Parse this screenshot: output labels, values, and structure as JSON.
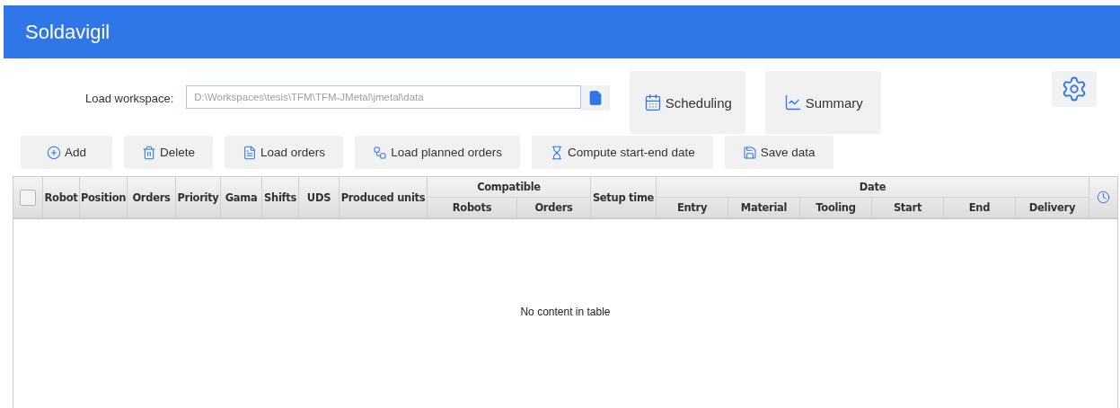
{
  "app": {
    "title": "Soldavigil"
  },
  "workspace": {
    "label": "Load workspace:",
    "value": "D:\\Workspaces\\tesis\\TFM\\TFM-JMetal\\jmetal\\data",
    "disabled": true
  },
  "nav_buttons": [
    {
      "kind": "calendar",
      "label": "Scheduling"
    },
    {
      "kind": "chart",
      "label": "Summary"
    }
  ],
  "toolbar": [
    {
      "kind": "add",
      "label": "Add"
    },
    {
      "kind": "delete",
      "label": "Delete"
    },
    {
      "kind": "file",
      "label": "Load orders"
    },
    {
      "kind": "plan",
      "label": "Load planned orders"
    },
    {
      "kind": "hourglass",
      "label": "Compute start-end date"
    },
    {
      "kind": "save",
      "label": "Save data"
    }
  ],
  "table": {
    "select_all": {
      "checked": false
    },
    "columns": [
      {
        "label": "Robot"
      },
      {
        "label": "Position"
      },
      {
        "label": "Orders"
      },
      {
        "label": "Priority"
      },
      {
        "label": "Gama"
      },
      {
        "label": "Shifts"
      },
      {
        "label": "UDS"
      },
      {
        "label": "Produced units"
      },
      {
        "label": "Compatible",
        "children": [
          {
            "label": "Robots"
          },
          {
            "label": "Orders"
          }
        ]
      },
      {
        "label": "Setup time"
      },
      {
        "label": "Date",
        "children": [
          {
            "label": "Entry"
          },
          {
            "label": "Material"
          },
          {
            "label": "Tooling"
          },
          {
            "label": "Start"
          },
          {
            "label": "End"
          },
          {
            "label": "Delivery"
          }
        ]
      }
    ],
    "empty_message": "No content in table"
  }
}
